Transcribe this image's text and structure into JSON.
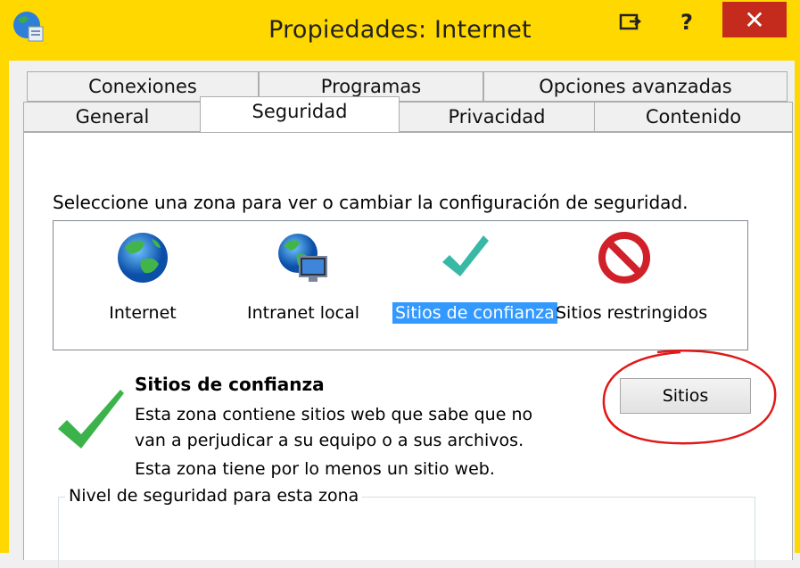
{
  "window": {
    "title": "Propiedades: Internet",
    "help_label": "?",
    "close_label": "✕"
  },
  "tabs": {
    "back_row": [
      "Conexiones",
      "Programas",
      "Opciones avanzadas"
    ],
    "front_row": [
      "General",
      "Seguridad",
      "Privacidad",
      "Contenido"
    ],
    "active": "Seguridad"
  },
  "security": {
    "intro": "Seleccione una zona para ver o cambiar la configuración de seguridad.",
    "zones": [
      {
        "label": "Internet",
        "icon": "globe-icon"
      },
      {
        "label": "Intranet local",
        "icon": "intranet-globe-icon"
      },
      {
        "label": "Sitios de confianza",
        "icon": "checkmark-icon",
        "selected": true
      },
      {
        "label": "Sitios restringidos",
        "icon": "prohibited-icon"
      }
    ],
    "selected_zone_title": "Sitios de confianza",
    "selected_zone_description_line1": "Esta zona contiene sitios web que sabe que no",
    "selected_zone_description_line2": "van a perjudicar a su equipo o a sus archivos.",
    "site_count_text": "Esta zona tiene por lo menos un sitio web.",
    "sites_button": "Sitios",
    "level_group_label": "Nivel de seguridad para esta zona"
  },
  "colors": {
    "titlebar": "#ffd800",
    "close_button": "#c42b1c",
    "selection": "#3399ff",
    "annotation": "#e01818"
  }
}
